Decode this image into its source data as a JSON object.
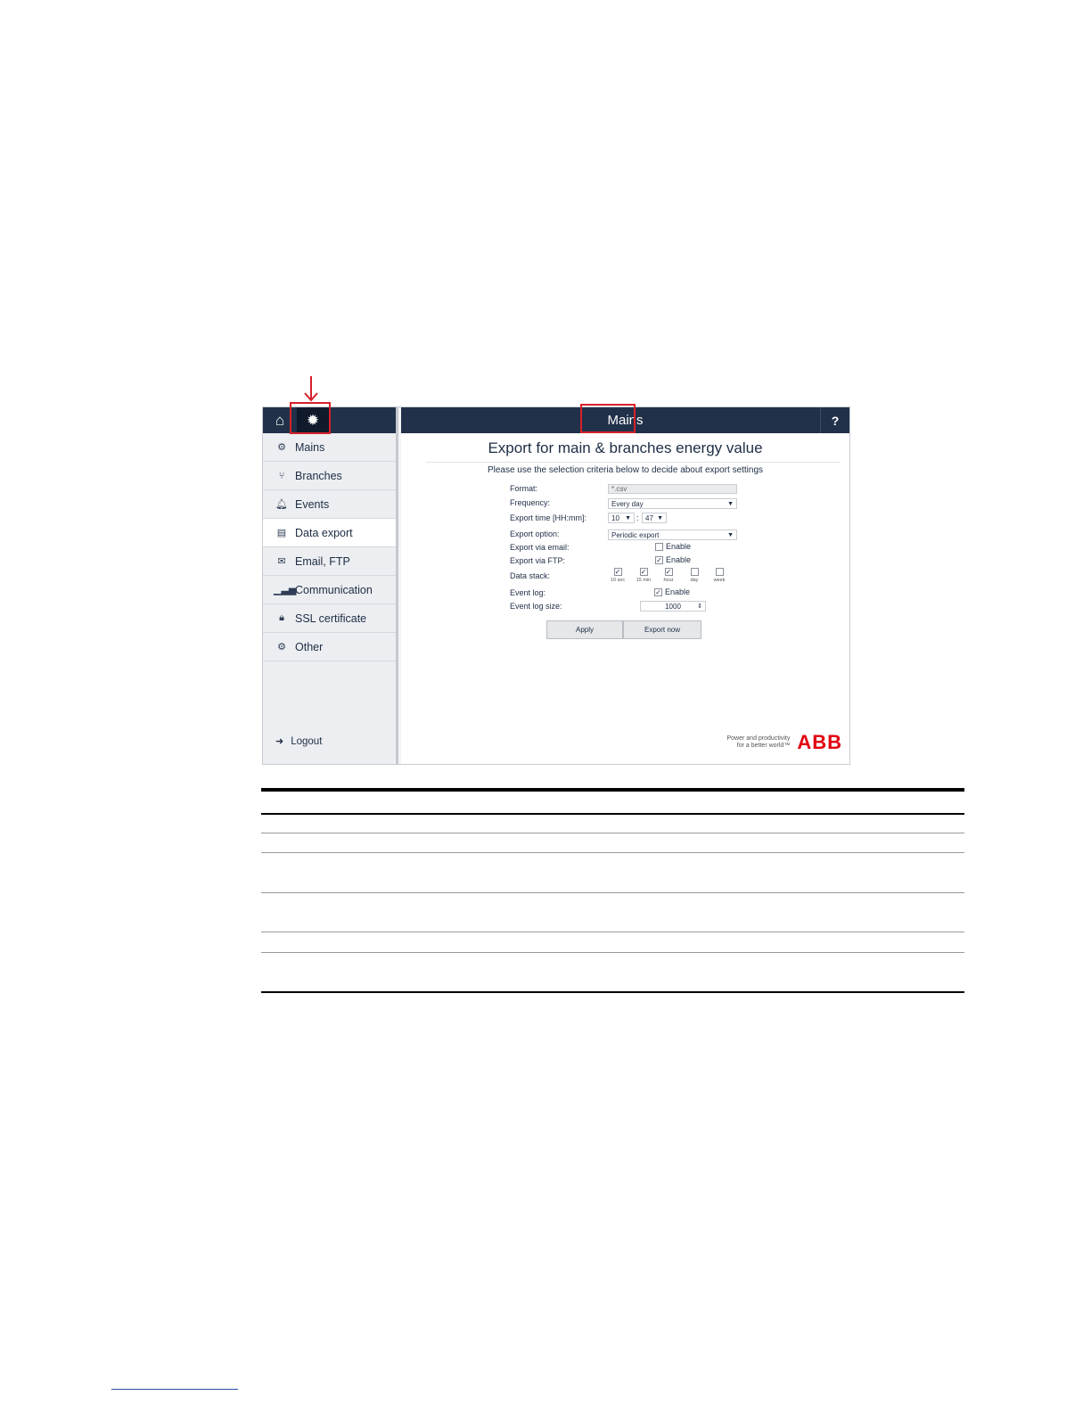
{
  "sidebar": {
    "items": [
      {
        "label": "Mains",
        "icon": "gears-icon"
      },
      {
        "label": "Branches",
        "icon": "branch-icon"
      },
      {
        "label": "Events",
        "icon": "bell-icon"
      },
      {
        "label": "Data export",
        "icon": "document-icon"
      },
      {
        "label": "Email, FTP",
        "icon": "envelope-icon"
      },
      {
        "label": "Communication",
        "icon": "signal-icon"
      },
      {
        "label": "SSL certificate",
        "icon": "lock-icon"
      },
      {
        "label": "Other",
        "icon": "gear-icon"
      }
    ],
    "active": "Data export",
    "logout_label": "Logout"
  },
  "header": {
    "title": "Mains",
    "help": "?"
  },
  "main": {
    "heading": "Export for main & branches energy value",
    "instructions": "Please use the selection criteria below to decide about export settings",
    "form": {
      "format_label": "Format:",
      "format_value": "*.csv",
      "frequency_label": "Frequency:",
      "frequency_value": "Every day",
      "export_time_label": "Export time [HH:mm]:",
      "export_hour": "10",
      "time_separator": ":",
      "export_minute": "47",
      "export_option_label": "Export option:",
      "export_option_value": "Periodic export",
      "email_label": "Export via email:",
      "email_enable": "Enable",
      "ftp_label": "Export via FTP:",
      "ftp_enable": "Enable",
      "data_stack_label": "Data stack:",
      "stack": [
        {
          "label": "10 sec",
          "checked": true
        },
        {
          "label": "15 min",
          "checked": true
        },
        {
          "label": "hour",
          "checked": true
        },
        {
          "label": "day",
          "checked": false
        },
        {
          "label": "week",
          "checked": false
        }
      ],
      "event_log_label": "Event log:",
      "event_log_enable": "Enable",
      "event_log_size_label": "Event log size:",
      "event_log_size_value": "1000"
    },
    "apply_label": "Apply",
    "export_now_label": "Export now"
  },
  "brand": {
    "tagline_1": "Power and productivity",
    "tagline_2": "for a better world™",
    "logo": "ABB"
  },
  "colors": {
    "header": "#213149",
    "highlight": "#d6212b",
    "brand": "#e2000f"
  }
}
